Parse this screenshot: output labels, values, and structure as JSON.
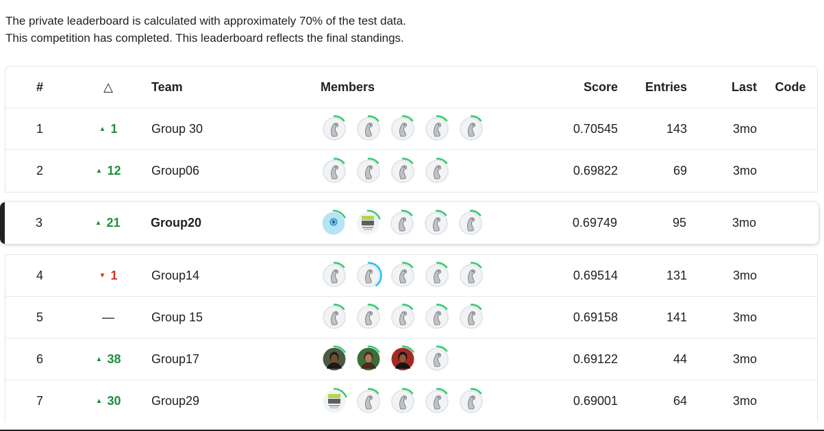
{
  "notice": {
    "line1": "The private leaderboard is calculated with approximately 70% of the test data.",
    "line2": "This competition has completed. This leaderboard reflects the final standings."
  },
  "headers": {
    "rank": "#",
    "delta": "△",
    "team": "Team",
    "members": "Members",
    "score": "Score",
    "entries": "Entries",
    "last": "Last",
    "code": "Code"
  },
  "rows": [
    {
      "rank": "1",
      "delta": "1",
      "dir": "up",
      "team": "Group 30",
      "members": [
        "goose",
        "goose",
        "goose",
        "goose",
        "goose"
      ],
      "score": "0.70545",
      "entries": "143",
      "last": "3mo"
    },
    {
      "rank": "2",
      "delta": "12",
      "dir": "up",
      "team": "Group06",
      "members": [
        "goose",
        "goose",
        "goose",
        "goose"
      ],
      "score": "0.69822",
      "entries": "69",
      "last": "3mo"
    },
    {
      "rank": "3",
      "delta": "21",
      "dir": "up",
      "team": "Group20",
      "members": [
        "blue-avatar",
        "nova-ims-logo",
        "goose",
        "goose",
        "goose"
      ],
      "score": "0.69749",
      "entries": "95",
      "last": "3mo"
    },
    {
      "rank": "4",
      "delta": "1",
      "dir": "down",
      "team": "Group14",
      "members": [
        "goose",
        "goose-blue",
        "goose",
        "goose",
        "goose"
      ],
      "score": "0.69514",
      "entries": "131",
      "last": "3mo"
    },
    {
      "rank": "5",
      "delta": "—",
      "dir": "same",
      "team": "Group 15",
      "members": [
        "goose",
        "goose",
        "goose",
        "goose",
        "goose"
      ],
      "score": "0.69158",
      "entries": "141",
      "last": "3mo"
    },
    {
      "rank": "6",
      "delta": "38",
      "dir": "up",
      "team": "Group17",
      "members": [
        "photo-1",
        "photo-2",
        "photo-3",
        "goose"
      ],
      "score": "0.69122",
      "entries": "44",
      "last": "3mo"
    },
    {
      "rank": "7",
      "delta": "30",
      "dir": "up",
      "team": "Group29",
      "members": [
        "nova-ims-logo",
        "goose",
        "goose",
        "goose",
        "goose"
      ],
      "score": "0.69001",
      "entries": "64",
      "last": "3mo"
    }
  ],
  "colors": {
    "up": "#1e8e3e",
    "down": "#d93025",
    "ring": "#20beff",
    "ring_green": "#35c870"
  }
}
